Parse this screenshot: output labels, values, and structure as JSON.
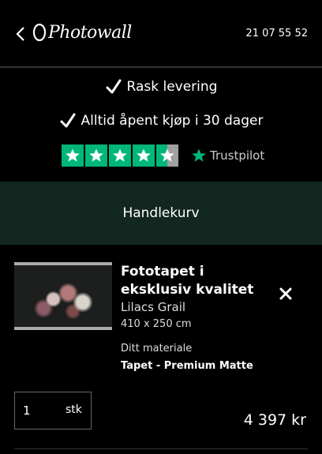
{
  "header": {
    "logo_text": "Photowall",
    "phone": "21 07 55 52"
  },
  "usps": [
    {
      "text": "Rask levering"
    },
    {
      "text": "Alltid åpent kjøp i 30 dager"
    }
  ],
  "trustpilot": {
    "brand": "Trustpilot",
    "rating": 4.5,
    "max": 5,
    "color": "#00b67a"
  },
  "cart": {
    "banner_title": "Handlekurv",
    "banner_color": "#12271f",
    "item": {
      "title": "Fototapet i eksklusiv kvalitet",
      "variant": "Lilacs Grail",
      "size": "410 x 250 cm",
      "material_label": "Ditt materiale",
      "material_value": "Tapet - Premium Matte",
      "quantity": "1",
      "quantity_unit": "stk",
      "price": "4 397 kr"
    }
  }
}
